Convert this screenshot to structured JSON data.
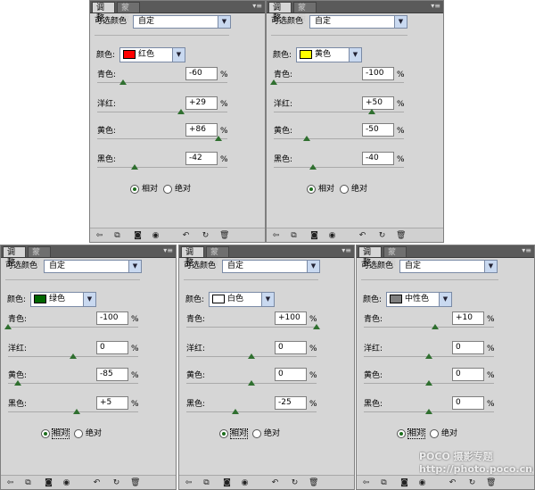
{
  "panels": [
    {
      "tab_adjust": "调整",
      "tab_mask": "蒙版",
      "preset_label": "可选颜色",
      "preset_value": "自定",
      "color_label": "颜色:",
      "color_value": "红色",
      "swatch_color": "#ff0000",
      "sliders": [
        {
          "label": "青色:",
          "value": "-60",
          "pct": "%",
          "level": -60
        },
        {
          "label": "洋红:",
          "value": "+29",
          "pct": "%",
          "level": 29
        },
        {
          "label": "黄色:",
          "value": "+86",
          "pct": "%",
          "level": 86
        },
        {
          "label": "黑色:",
          "value": "-42",
          "pct": "%",
          "level": -42
        }
      ],
      "radio_relative": "相对",
      "radio_absolute": "绝对"
    },
    {
      "tab_adjust": "调整",
      "tab_mask": "蒙版",
      "preset_label": "可选颜色",
      "preset_value": "自定",
      "color_label": "颜色:",
      "color_value": "黄色",
      "swatch_color": "#ffff00",
      "sliders": [
        {
          "label": "青色:",
          "value": "-100",
          "pct": "%",
          "level": -100
        },
        {
          "label": "洋红:",
          "value": "+50",
          "pct": "%",
          "level": 50
        },
        {
          "label": "黄色:",
          "value": "-50",
          "pct": "%",
          "level": -50
        },
        {
          "label": "黑色:",
          "value": "-40",
          "pct": "%",
          "level": -40
        }
      ],
      "radio_relative": "相对",
      "radio_absolute": "绝对"
    },
    {
      "tab_adjust": "调整",
      "tab_mask": "蒙版",
      "preset_label": "可选颜色",
      "preset_value": "自定",
      "color_label": "颜色:",
      "color_value": "绿色",
      "swatch_color": "#006600",
      "sliders": [
        {
          "label": "青色:",
          "value": "-100",
          "pct": "%",
          "level": -100
        },
        {
          "label": "洋红:",
          "value": "0",
          "pct": "%",
          "level": 0
        },
        {
          "label": "黄色:",
          "value": "-85",
          "pct": "%",
          "level": -85
        },
        {
          "label": "黑色:",
          "value": "+5",
          "pct": "%",
          "level": 5
        }
      ],
      "radio_relative": "相对",
      "radio_absolute": "绝对"
    },
    {
      "tab_adjust": "调整",
      "tab_mask": "蒙版",
      "preset_label": "可选颜色",
      "preset_value": "自定",
      "color_label": "颜色:",
      "color_value": "白色",
      "swatch_color": "#ffffff",
      "sliders": [
        {
          "label": "青色:",
          "value": "+100",
          "pct": "%",
          "level": 100
        },
        {
          "label": "洋红:",
          "value": "0",
          "pct": "%",
          "level": 0
        },
        {
          "label": "黄色:",
          "value": "0",
          "pct": "%",
          "level": 0
        },
        {
          "label": "黑色:",
          "value": "-25",
          "pct": "%",
          "level": -25
        }
      ],
      "radio_relative": "相对",
      "radio_absolute": "绝对"
    },
    {
      "tab_adjust": "调整",
      "tab_mask": "蒙版",
      "preset_label": "可选颜色",
      "preset_value": "自定",
      "color_label": "颜色:",
      "color_value": "中性色",
      "swatch_color": "#808080",
      "sliders": [
        {
          "label": "青色:",
          "value": "+10",
          "pct": "%",
          "level": 10
        },
        {
          "label": "洋红:",
          "value": "0",
          "pct": "%",
          "level": 0
        },
        {
          "label": "黄色:",
          "value": "0",
          "pct": "%",
          "level": 0
        },
        {
          "label": "黑色:",
          "value": "0",
          "pct": "%",
          "level": 0
        }
      ],
      "radio_relative": "相对",
      "radio_absolute": "绝对"
    }
  ],
  "icons": [
    "back-arrow-icon",
    "fit-screen-icon",
    "visibility-icon",
    "eye-icon",
    "reset-previous-icon",
    "reset-icon",
    "trash-icon"
  ],
  "watermark": "POCO 摄影专题 http://photo.poco.cn/"
}
